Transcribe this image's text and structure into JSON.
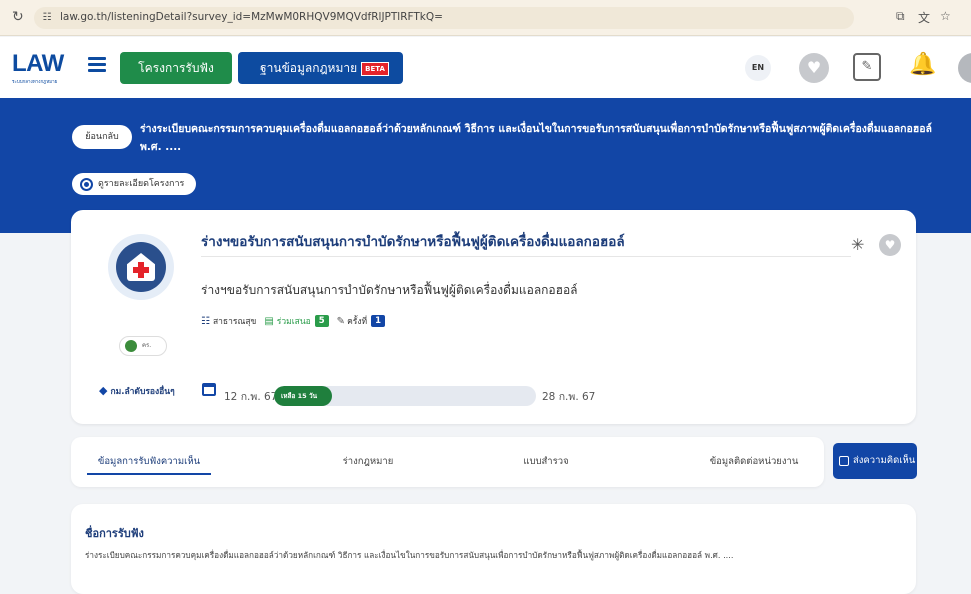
{
  "browser": {
    "url": "law.go.th/listeningDetail?survey_id=MzMwM0RHQV9MQVdfRlJPTlRFTkQ="
  },
  "header": {
    "logo": "LAW",
    "logo_sub": "ระบบกลางทางกฎหมาย",
    "projects_label": "โครงการรับฟัง",
    "lawdb_label": "ฐานข้อมูลกฎหมาย",
    "beta_label": "BETA",
    "lang_label": "EN"
  },
  "banner": {
    "back_label": "ย้อนกลับ",
    "title": "ร่างระเบียบคณะกรรมการควบคุมเครื่องดื่มแอลกอฮอล์ว่าด้วยหลักเกณฑ์ วิธีการ และเงื่อนไขในการขอรับการสนับสนุนเพื่อการบำบัดรักษาหรือฟื้นฟูสภาพผู้ติดเครื่องดื่มแอลกอฮอล์ พ.ศ. ....",
    "details_label": "ดูรายละเอียดโครงการ"
  },
  "project": {
    "title": "ร่างฯขอรับการสนับสนุนการบำบัดรักษาหรือฟื้นฟูผู้ติดเครื่องดื่มแอลกอฮอล์",
    "description": "ร่างฯขอรับการสนับสนุนการบำบัดรักษาหรือฟื้นฟูผู้ติดเครื่องดื่มแอลกอฮอล์",
    "agency": "คร.",
    "category": "สาธารณสุข",
    "participants_label": "ร่วมเสนอ",
    "participants_count": "5",
    "round_label": "ครั้งที่",
    "round_count": "1",
    "tag": "กม.ลำดับรองอื่นๆ",
    "date_start": "12 ก.พ. 67",
    "date_end": "28 ก.พ. 67",
    "remaining_label": "เหลือ 15 วัน",
    "progress_fraction": 0.22
  },
  "tabs": {
    "hearing": "ข้อมูลการรับฟังความเห็น",
    "draft_law": "ร่างกฎหมาย",
    "survey": "แบบสำรวจ",
    "contact": "ข้อมูลติดต่อหน่วยงาน",
    "submit_comment": "ส่งความคิดเห็น"
  },
  "hearing": {
    "heading": "ชื่อการรับฟัง",
    "text": "ร่างระเบียบคณะกรรมการควบคุมเครื่องดื่มแอลกอฮอล์ว่าด้วยหลักเกณฑ์ วิธีการ และเงื่อนไขในการขอรับการสนับสนุนเพื่อการบำบัดรักษาหรือฟื้นฟูสภาพผู้ติดเครื่องดื่มแอลกอฮอล์ พ.ศ. ...."
  },
  "colors": {
    "primary": "#1246a6",
    "green": "#1f8c4a",
    "beta": "#e4232a"
  }
}
